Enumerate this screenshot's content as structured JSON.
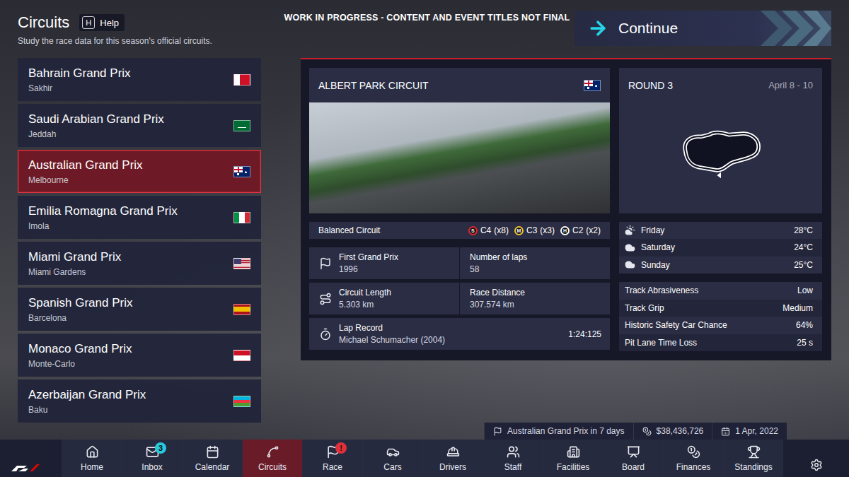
{
  "header": {
    "title": "Circuits",
    "help_key": "H",
    "help_label": "Help",
    "subtitle": "Study the race data for this season's official circuits."
  },
  "banner": "WORK IN PROGRESS - CONTENT AND EVENT TITLES NOT FINAL",
  "continue_button": {
    "label": "Continue"
  },
  "circuits": [
    {
      "name": "Bahrain Grand Prix",
      "location": "Sakhir",
      "kind": "bahrain",
      "selected": false
    },
    {
      "name": "Saudi Arabian Grand Prix",
      "location": "Jeddah",
      "kind": "saudi",
      "selected": false
    },
    {
      "name": "Australian Grand Prix",
      "location": "Melbourne",
      "kind": "australia",
      "selected": true
    },
    {
      "name": "Emilia Romagna Grand Prix",
      "location": "Imola",
      "kind": "italy",
      "selected": false
    },
    {
      "name": "Miami Grand Prix",
      "location": "Miami Gardens",
      "kind": "usa",
      "selected": false
    },
    {
      "name": "Spanish Grand Prix",
      "location": "Barcelona",
      "kind": "spain",
      "selected": false
    },
    {
      "name": "Monaco Grand Prix",
      "location": "Monte-Carlo",
      "kind": "monaco",
      "selected": false
    },
    {
      "name": "Azerbaijan Grand Prix",
      "location": "Baku",
      "kind": "azerbaijan",
      "selected": false
    }
  ],
  "circuit": {
    "name": "ALBERT PARK CIRCUIT",
    "kind": "australia",
    "character": "Balanced Circuit",
    "tyres": [
      {
        "letter": "S",
        "compound": "C4",
        "count": "(x8)",
        "color": "#e8262e"
      },
      {
        "letter": "M",
        "compound": "C3",
        "count": "(x3)",
        "color": "#f3c433"
      },
      {
        "letter": "H",
        "compound": "C2",
        "count": "(x2)",
        "color": "#ffffff"
      }
    ],
    "stats": [
      {
        "label": "First Grand Prix",
        "value": "1996",
        "kind": "flag"
      },
      {
        "label": "Number of laps",
        "value": "58",
        "kind": "plain"
      },
      {
        "label": "Circuit Length",
        "value": "5.303 km",
        "kind": "length"
      },
      {
        "label": "Race Distance",
        "value": "307.574 km",
        "kind": "plain"
      }
    ],
    "lap_record": {
      "label": "Lap Record",
      "holder": "Michael Schumacher (2004)",
      "time": "1:24:125"
    }
  },
  "round": {
    "label": "ROUND 3",
    "dates": "April 8 - 10"
  },
  "weather": [
    {
      "day": "Friday",
      "temp": "28°C",
      "kind": "partly-cloudy"
    },
    {
      "day": "Saturday",
      "temp": "24°C",
      "kind": "cloudy"
    },
    {
      "day": "Sunday",
      "temp": "25°C",
      "kind": "cloudy"
    }
  ],
  "track_info": [
    {
      "label": "Track Abrasiveness",
      "value": "Low"
    },
    {
      "label": "Track Grip",
      "value": "Medium"
    },
    {
      "label": "Historic Safety Car Chance",
      "value": "64%"
    },
    {
      "label": "Pit Lane Time Loss",
      "value": "25 s"
    }
  ],
  "status_bar": {
    "next_event": "Australian Grand Prix in 7 days",
    "money": "$38,436,726",
    "date": "1 Apr, 2022"
  },
  "nav": [
    {
      "label": "Home",
      "kind": "home",
      "selected": false
    },
    {
      "label": "Inbox",
      "kind": "inbox",
      "selected": false,
      "badge": {
        "text": "3",
        "color": "#27c9dc"
      }
    },
    {
      "label": "Calendar",
      "kind": "calendar",
      "selected": false
    },
    {
      "label": "Circuits",
      "kind": "circuits",
      "selected": true
    },
    {
      "label": "Race",
      "kind": "race",
      "selected": false,
      "badge": {
        "text": "!",
        "color": "#e0303a"
      }
    },
    {
      "label": "Cars",
      "kind": "cars",
      "selected": false
    },
    {
      "label": "Drivers",
      "kind": "drivers",
      "selected": false
    },
    {
      "label": "Staff",
      "kind": "staff",
      "selected": false
    },
    {
      "label": "Facilities",
      "kind": "facilities",
      "selected": false
    },
    {
      "label": "Board",
      "kind": "board",
      "selected": false
    },
    {
      "label": "Finances",
      "kind": "finances",
      "selected": false
    },
    {
      "label": "Standings",
      "kind": "standings",
      "selected": false
    }
  ]
}
